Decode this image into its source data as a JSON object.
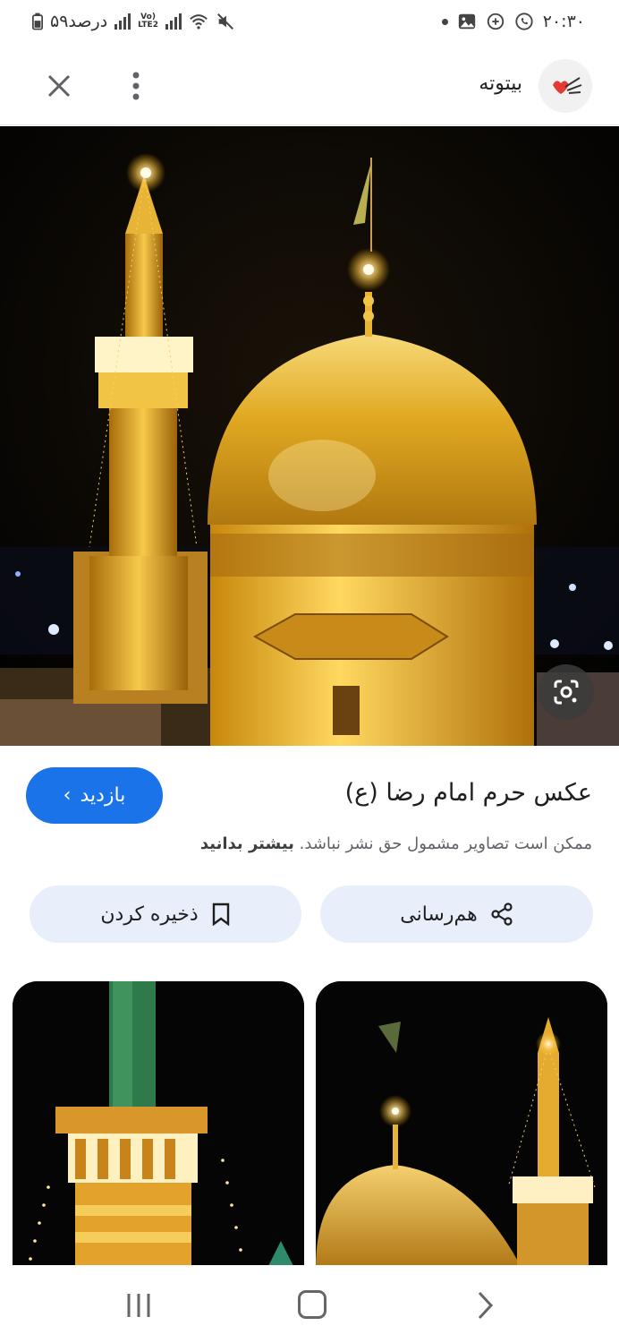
{
  "status_bar": {
    "time": "۲۰:۳۰",
    "battery": "۵۹درصد",
    "network": "LTE2"
  },
  "app_bar": {
    "site_name": "بیتوته"
  },
  "hero": {
    "image_alt": "عکس حرم امام رضا (ع)"
  },
  "info": {
    "title": "عکس حرم امام رضا (ع)",
    "visit_label": "بازدید",
    "copyright_text": "ممکن است تصاویر مشمول حق نشر نباشد.",
    "learn_more": "بیشتر بدانید"
  },
  "actions": {
    "share_label": "هم‌رسانی",
    "save_label": "ذخیره کردن"
  },
  "colors": {
    "accent": "#1a73e8",
    "chip_bg": "#e8eefa"
  }
}
